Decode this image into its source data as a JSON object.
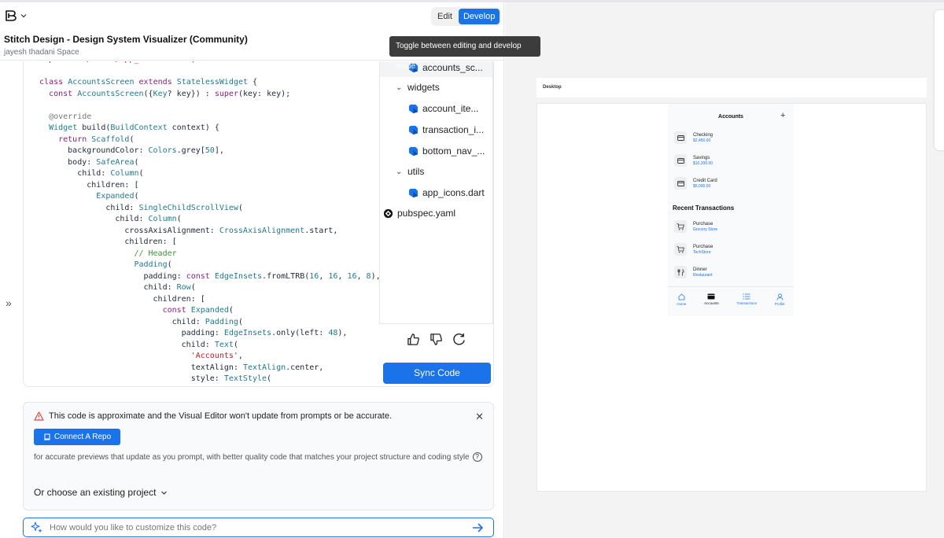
{
  "header": {
    "mode_edit": "Edit",
    "mode_develop": "Develop",
    "tooltip": "Toggle between editing and develop mode",
    "title": "Stitch Design - Design System Visualizer (Community)",
    "subtitle": "jayesh thadani Space"
  },
  "file_tree": [
    {
      "label": "accounts_sc...",
      "type": "file"
    },
    {
      "label": "widgets",
      "type": "folder"
    },
    {
      "label": "account_ite...",
      "type": "file"
    },
    {
      "label": "transaction_i...",
      "type": "file"
    },
    {
      "label": "bottom_nav_...",
      "type": "file"
    },
    {
      "label": "utils",
      "type": "folder"
    },
    {
      "label": "app_icons.dart",
      "type": "file"
    },
    {
      "label": "pubspec.yaml",
      "type": "yaml"
    }
  ],
  "sync_label": "Sync Code",
  "notice": {
    "message": "This code is approximate and the Visual Editor won't update from prompts or be accurate.",
    "connect_label": "Connect A Repo",
    "description": "for accurate previews that update as you prompt, with better quality code that matches your project structure and coding style",
    "existing_label": "Or choose an existing project"
  },
  "prompt": {
    "placeholder": "How would you like to customize this code?"
  },
  "preview": {
    "frame_label": "Desktop",
    "title": "Accounts",
    "plus": "+",
    "accounts": [
      {
        "name": "Checking",
        "amount": "$2,450.00"
      },
      {
        "name": "Savings",
        "amount": "$10,200.00"
      },
      {
        "name": "Credit Card",
        "amount": "$5,000.00"
      }
    ],
    "recent_title": "Recent Transactions",
    "transactions": [
      {
        "name": "Purchase",
        "merchant": "Grocery Store",
        "icon": "cart-icon"
      },
      {
        "name": "Purchase",
        "merchant": "TechStore",
        "icon": "cart-icon"
      },
      {
        "name": "Dinner",
        "merchant": "Restaurant",
        "icon": "fork-knife-icon"
      }
    ],
    "nav": [
      {
        "label": "Home",
        "icon": "home-icon"
      },
      {
        "label": "Accounts",
        "icon": "card-icon",
        "active": true
      },
      {
        "label": "Transactions",
        "icon": "list-icon"
      },
      {
        "label": "Profile",
        "icon": "person-icon"
      }
    ]
  },
  "colors": {
    "accent": "#1a73e8",
    "keyword": "#8b1f7a",
    "type": "#1f7a8c",
    "string": "#b5222a",
    "comment": "#3f8f3f"
  }
}
